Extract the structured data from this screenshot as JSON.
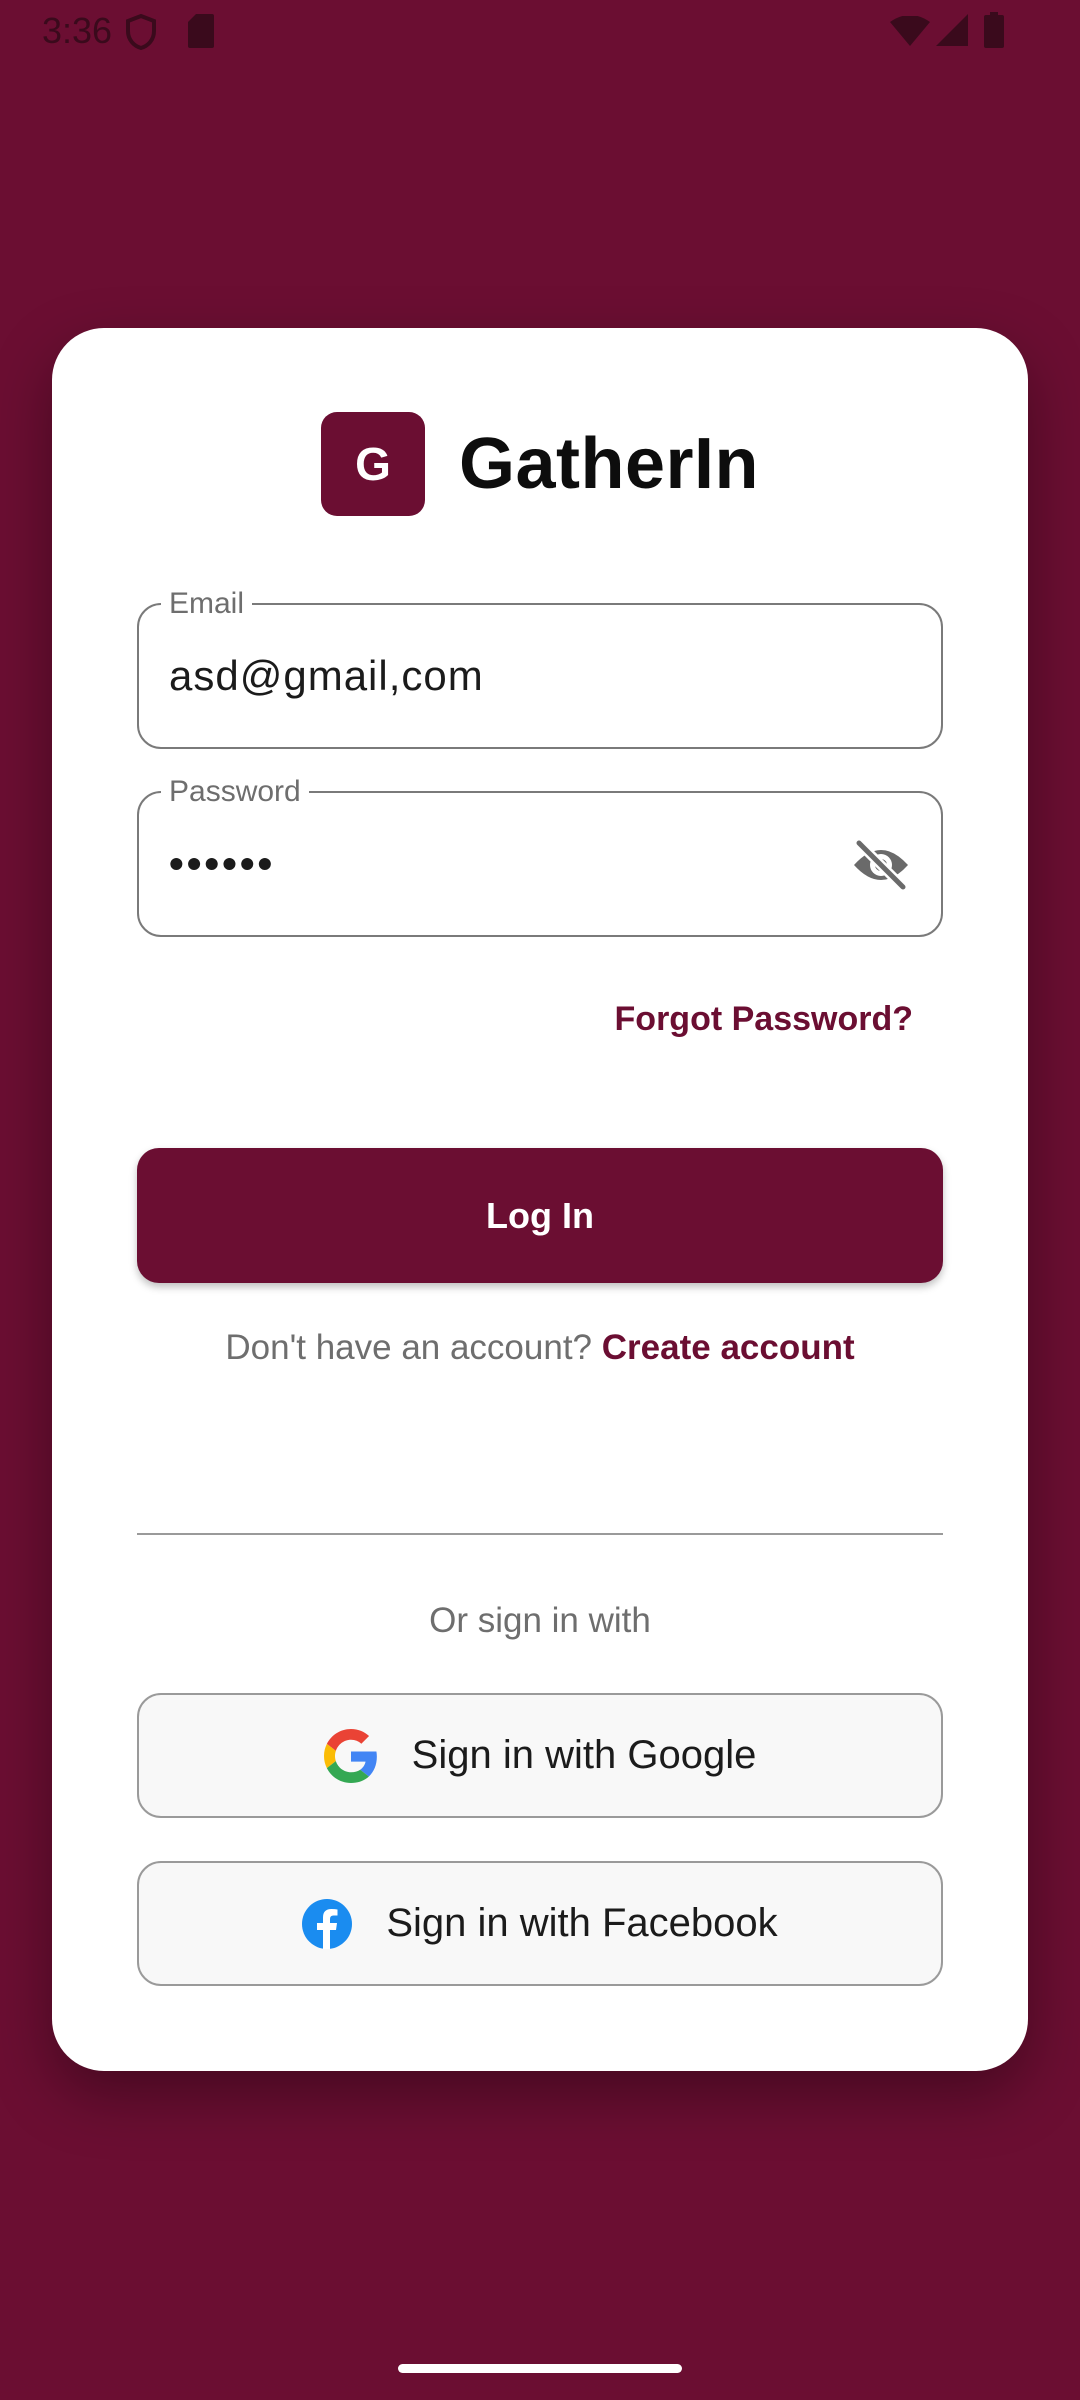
{
  "status_bar": {
    "time": "3:36",
    "icons": [
      "shield-icon",
      "sd-card-icon",
      "wifi-icon",
      "cellular-signal-icon",
      "battery-icon"
    ]
  },
  "colors": {
    "brand": "#6b0e32",
    "background": "#6b0e32",
    "card": "#ffffff"
  },
  "brand": {
    "logo_letter": "G",
    "name": "GatherIn"
  },
  "email_field": {
    "label": "Email",
    "value": "asd@gmail,com"
  },
  "password_field": {
    "label": "Password",
    "value": "••••••",
    "toggle_icon": "eye-off-icon"
  },
  "forgot_password": "Forgot Password?",
  "login_button": "Log In",
  "signup": {
    "prompt": "Don't have an account?",
    "link": "Create account"
  },
  "social": {
    "divider_text": "Or sign in with",
    "google_label": "Sign in with Google",
    "google_icon": "google-icon",
    "facebook_label": "Sign in with Facebook",
    "facebook_icon": "facebook-icon"
  }
}
